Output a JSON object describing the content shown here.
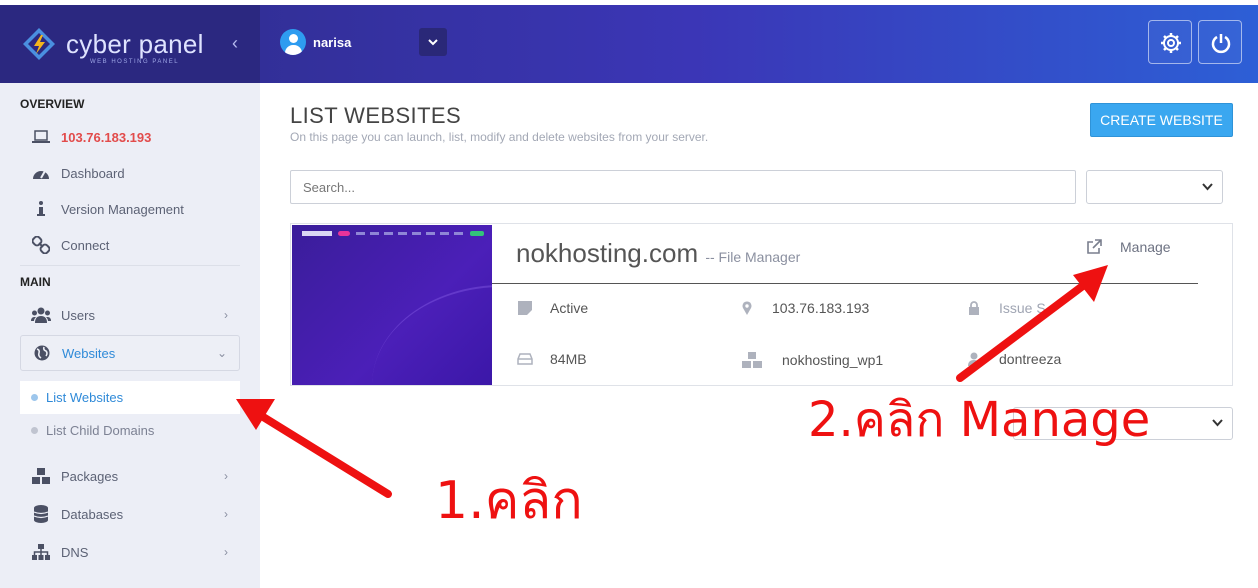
{
  "brand": {
    "name": "cyber panel",
    "tagline": "WEB HOSTING PANEL"
  },
  "header": {
    "username": "narisa",
    "icons": [
      "gear-icon",
      "power-icon"
    ]
  },
  "sidebar": {
    "sections": [
      "OVERVIEW",
      "MAIN"
    ],
    "ip": "103.76.183.193",
    "overview_items": [
      {
        "label": "Dashboard",
        "icon": "dashboard-icon"
      },
      {
        "label": "Version Management",
        "icon": "info-icon"
      },
      {
        "label": "Connect",
        "icon": "link-icon"
      }
    ],
    "main_items": [
      {
        "label": "Users",
        "icon": "users-icon"
      },
      {
        "label": "Websites",
        "icon": "globe-icon"
      },
      {
        "label": "Packages",
        "icon": "cubes-icon"
      },
      {
        "label": "Databases",
        "icon": "database-icon"
      },
      {
        "label": "DNS",
        "icon": "sitemap-icon"
      }
    ],
    "websites_sub": [
      "List Websites",
      "List Child Domains"
    ]
  },
  "main": {
    "title": "LIST WEBSITES",
    "subtitle": "On this page you can launch, list, modify and delete websites from your server.",
    "create_button": "CREATE WEBSITE",
    "search_placeholder": "Search..."
  },
  "site": {
    "domain": "nokhosting.com",
    "file_manager": "-- File Manager",
    "manage": "Manage",
    "status": "Active",
    "ip": "103.76.183.193",
    "ssl": "Issue S",
    "disk": "84MB",
    "package": "nokhosting_wp1",
    "owner": "dontreeza"
  },
  "annotations": {
    "step1": "1.คลิก",
    "step2": "2.คลิก Manage"
  },
  "colors": {
    "accent": "#3aa7f0",
    "ip": "#e24b4b",
    "annotation": "#ee1111"
  }
}
